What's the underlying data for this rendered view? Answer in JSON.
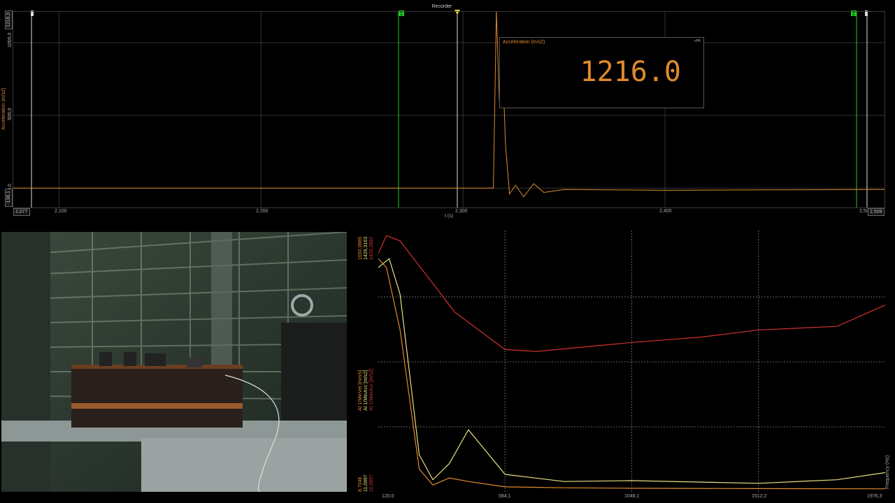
{
  "recorder": {
    "title": "Recorder",
    "y_axis_label": "Acceleration (m/s2)",
    "x_axis_label": "t (s)",
    "y_ticks": [
      "1216,0",
      "1000,0",
      "500,0",
      "0,0",
      "-138,1"
    ],
    "x_ticks": [
      "2,077",
      "2,100",
      "2,200",
      "2,300",
      "2,400",
      "2,50",
      "2,509"
    ],
    "cursor_labels": [
      "1",
      "2"
    ],
    "readout": {
      "title": "Acceleration (m/s2)",
      "tag": "+PK",
      "value": "1216.0"
    },
    "colors": {
      "trace": "#e08a2c",
      "cursor": "#22cc22",
      "marker": "#ffe14d"
    }
  },
  "video": {
    "description_icon": "camera-frame-icon"
  },
  "fft": {
    "x_axis_label": "Frequency (Hz)",
    "x_ticks": [
      "120,0",
      "584,1",
      "1048,1",
      "1512,2",
      "1976,3"
    ],
    "channels": [
      {
        "label": "AI 1/MinVel [mm/s]",
        "top": "1550,0885",
        "bottom": "8,7046",
        "color": "#e08a2c"
      },
      {
        "label": "AI 1/MinAcc [m/s2]",
        "top": "1429,3163",
        "bottom": "11,0997",
        "color": "#e8e080"
      },
      {
        "label": "AI 1/MaxAcc [m/s2]",
        "top": "1429,2682",
        "bottom": "11,0997",
        "color": "#d03030"
      }
    ]
  },
  "chart_data": [
    {
      "type": "line",
      "title": "Recorder",
      "xlabel": "t (s)",
      "ylabel": "Acceleration (m/s2)",
      "xlim": [
        2.077,
        2.509
      ],
      "ylim": [
        -138.1,
        1216.0
      ],
      "grid": true,
      "series": [
        {
          "name": "Acceleration (m/s2)",
          "x": [
            2.077,
            2.1,
            2.2,
            2.3,
            2.315,
            2.3165,
            2.318,
            2.3195,
            2.321,
            2.323,
            2.326,
            2.33,
            2.335,
            2.34,
            2.35,
            2.4,
            2.45,
            2.509
          ],
          "values": [
            0,
            0,
            0,
            0,
            0,
            1216,
            600,
            900,
            300,
            -40,
            20,
            -60,
            30,
            -30,
            -10,
            -15,
            -12,
            -10
          ]
        }
      ]
    },
    {
      "type": "line",
      "xlabel": "Frequency (Hz)",
      "xlim": [
        120.0,
        1976.3
      ],
      "grid": true,
      "series": [
        {
          "name": "AI 1/MaxAcc [m/s2]",
          "x": [
            120,
            150,
            200,
            300,
            400,
            584.1,
            700,
            1048.1,
            1300,
            1512.2,
            1800,
            1976.3
          ],
          "values": [
            1330,
            1429.3,
            1400,
            1200,
            1000,
            790,
            780,
            830,
            860,
            900,
            920,
            1040
          ]
        },
        {
          "name": "AI 1/MinAcc [m/s2]",
          "x": [
            120,
            160,
            200,
            270,
            320,
            380,
            450,
            584.1,
            800,
            1048.1,
            1512.2,
            1800,
            1976.3
          ],
          "values": [
            1250,
            1300,
            1100,
            200,
            60,
            150,
            340,
            90,
            50,
            55,
            40,
            60,
            100
          ]
        },
        {
          "name": "AI 1/MinVel [mm/s]",
          "x": [
            120,
            150,
            200,
            270,
            320,
            380,
            450,
            584.1,
            800,
            1048.1,
            1512.2,
            1976.3
          ],
          "values": [
            1300,
            1250,
            900,
            120,
            30,
            70,
            50,
            20,
            15,
            12,
            10,
            9
          ]
        }
      ]
    }
  ]
}
